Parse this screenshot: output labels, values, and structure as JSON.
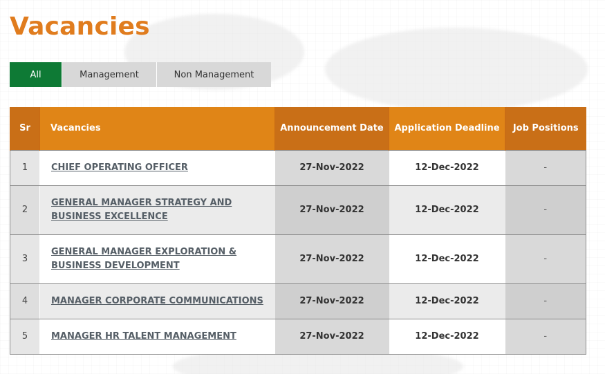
{
  "page": {
    "title": "Vacancies"
  },
  "tabs": [
    {
      "label": "All",
      "active": true
    },
    {
      "label": "Management",
      "active": false
    },
    {
      "label": "Non Management",
      "active": false
    }
  ],
  "table": {
    "headers": {
      "sr": "Sr",
      "vacancies": "Vacancies",
      "announcement_date": "Announcement Date",
      "application_deadline": "Application Deadline",
      "job_positions": "Job Positions"
    },
    "rows": [
      {
        "sr": "1",
        "title": "CHIEF OPERATING OFFICER",
        "announced": "27-Nov-2022",
        "deadline": "12-Dec-2022",
        "positions": "-"
      },
      {
        "sr": "2",
        "title": "GENERAL MANAGER STRATEGY AND BUSINESS EXCELLENCE",
        "announced": "27-Nov-2022",
        "deadline": "12-Dec-2022",
        "positions": "-"
      },
      {
        "sr": "3",
        "title": "GENERAL MANAGER EXPLORATION & BUSINESS DEVELOPMENT",
        "announced": "27-Nov-2022",
        "deadline": "12-Dec-2022",
        "positions": "-"
      },
      {
        "sr": "4",
        "title": "MANAGER CORPORATE COMMUNICATIONS",
        "announced": "27-Nov-2022",
        "deadline": "12-Dec-2022",
        "positions": "-"
      },
      {
        "sr": "5",
        "title": "MANAGER HR TALENT MANAGEMENT",
        "announced": "27-Nov-2022",
        "deadline": "12-Dec-2022",
        "positions": "-"
      }
    ]
  },
  "colors": {
    "title": "#e07c1e",
    "active_tab": "#0e7a35",
    "inactive_tab": "#d8d8d8",
    "header_dark": "#c96f17",
    "header_light": "#e08517"
  }
}
